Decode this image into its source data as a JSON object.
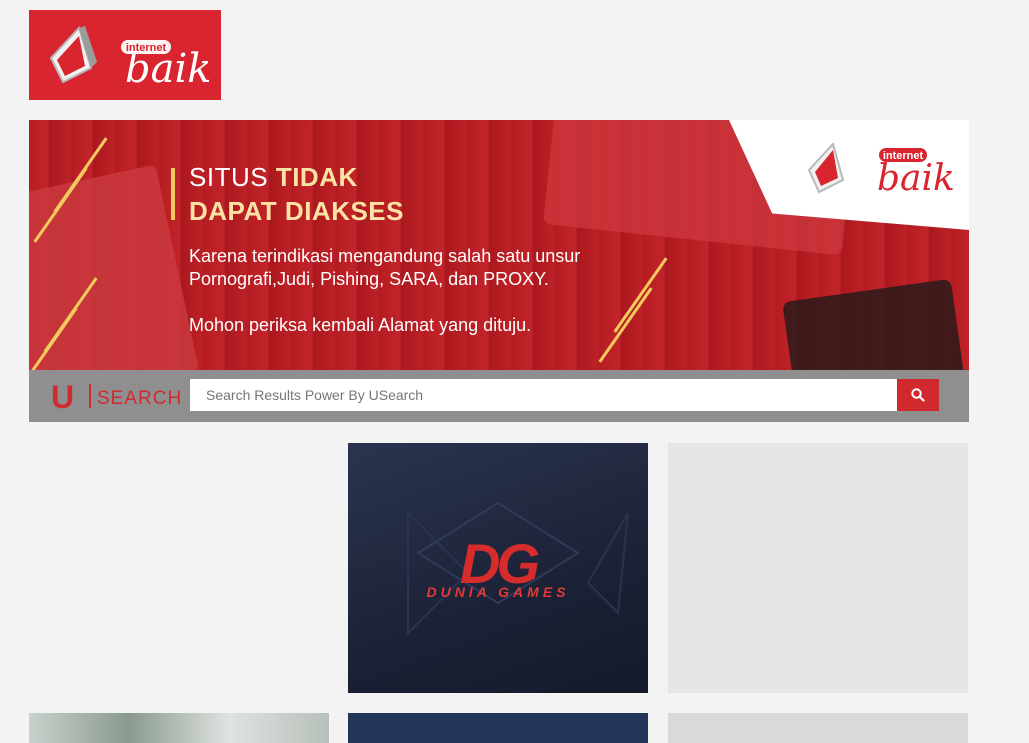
{
  "header": {
    "logo_small_word": "internet",
    "logo_big_word": "baik"
  },
  "banner": {
    "title_prefix": "SITUS",
    "title_emphasis": "TIDAK",
    "title_line2": "DAPAT DIAKSES",
    "body_line1": "Karena terindikasi mengandung salah satu unsur",
    "body_line2": "Pornografi,Judi, Pishing, SARA, dan PROXY.",
    "body_line3": "Mohon periksa kembali Alamat yang dituju."
  },
  "search": {
    "brand_letter": "U",
    "brand_word": "SEARCH",
    "placeholder": "Search Results Power By USearch",
    "button_icon": "search-icon"
  },
  "cards": {
    "dg_logo_text": "DG",
    "dg_tagline": "DUNIA GAMES"
  },
  "colors": {
    "brand_red": "#d12a2e",
    "banner_red": "#b71d22",
    "accent_yellow": "#f4c95d",
    "search_bar_gray": "#8f8f8f"
  }
}
